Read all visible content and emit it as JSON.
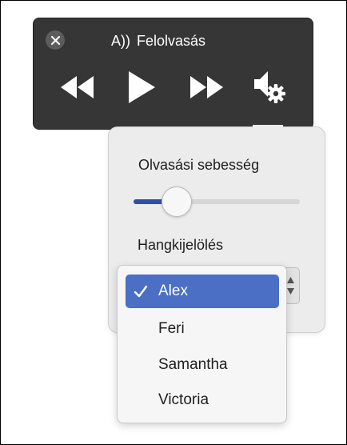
{
  "player": {
    "speaker_glyph": "A))",
    "title": "Felolvasás",
    "icons": {
      "close": "close-icon",
      "rewind": "rewind-icon",
      "play": "play-icon",
      "fast_forward": "fast-forward-icon",
      "voice_settings": "speaker-gear-icon"
    }
  },
  "panel": {
    "speed_label": "Olvasási sebesség",
    "speed_value_fraction": 0.26,
    "voice_label": "Hangkijelölés"
  },
  "voice_menu": {
    "items": [
      {
        "label": "Alex",
        "selected": true
      },
      {
        "label": "Feri",
        "selected": false
      },
      {
        "label": "Samantha",
        "selected": false
      },
      {
        "label": "Victoria",
        "selected": false
      }
    ]
  },
  "colors": {
    "player_bg": "#363636",
    "accent": "#4a6fc4",
    "slider_fill": "#2f4fa6"
  }
}
